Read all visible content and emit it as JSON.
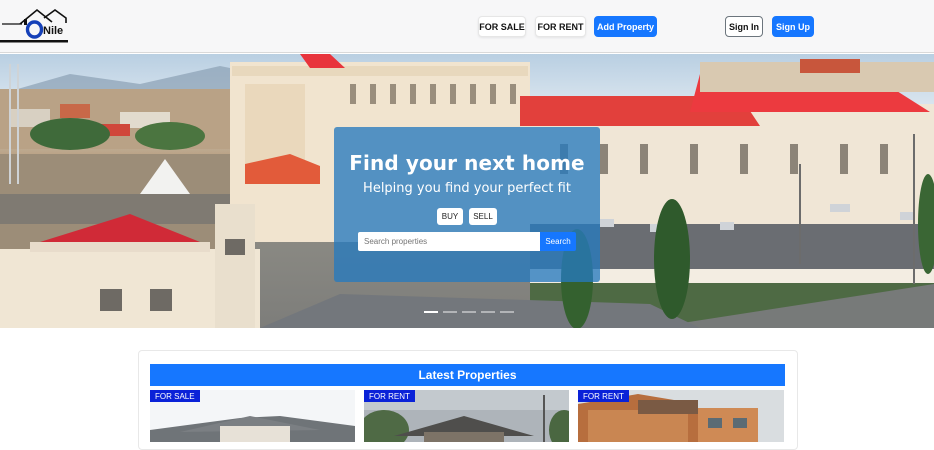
{
  "header": {
    "logo_text": "Nile",
    "nav": {
      "for_sale": "FOR SALE",
      "for_rent": "FOR RENT",
      "add_property": "Add Property",
      "sign_in": "Sign In",
      "sign_up": "Sign Up"
    }
  },
  "hero": {
    "title": "Find your next home",
    "subtitle": "Helping you find your perfect fit",
    "toggle_buy": "BUY",
    "toggle_sell": "SELL",
    "search_placeholder": "Search properties",
    "search_button": "Search",
    "slides_count": 5,
    "active_slide": 1
  },
  "latest": {
    "heading": "Latest Properties",
    "properties": [
      {
        "badge": "FOR SALE"
      },
      {
        "badge": "FOR RENT"
      },
      {
        "badge": "FOR RENT"
      }
    ]
  },
  "colors": {
    "primary": "#1677ff",
    "badge": "#0a22d8",
    "hero_panel": "#267abe"
  }
}
